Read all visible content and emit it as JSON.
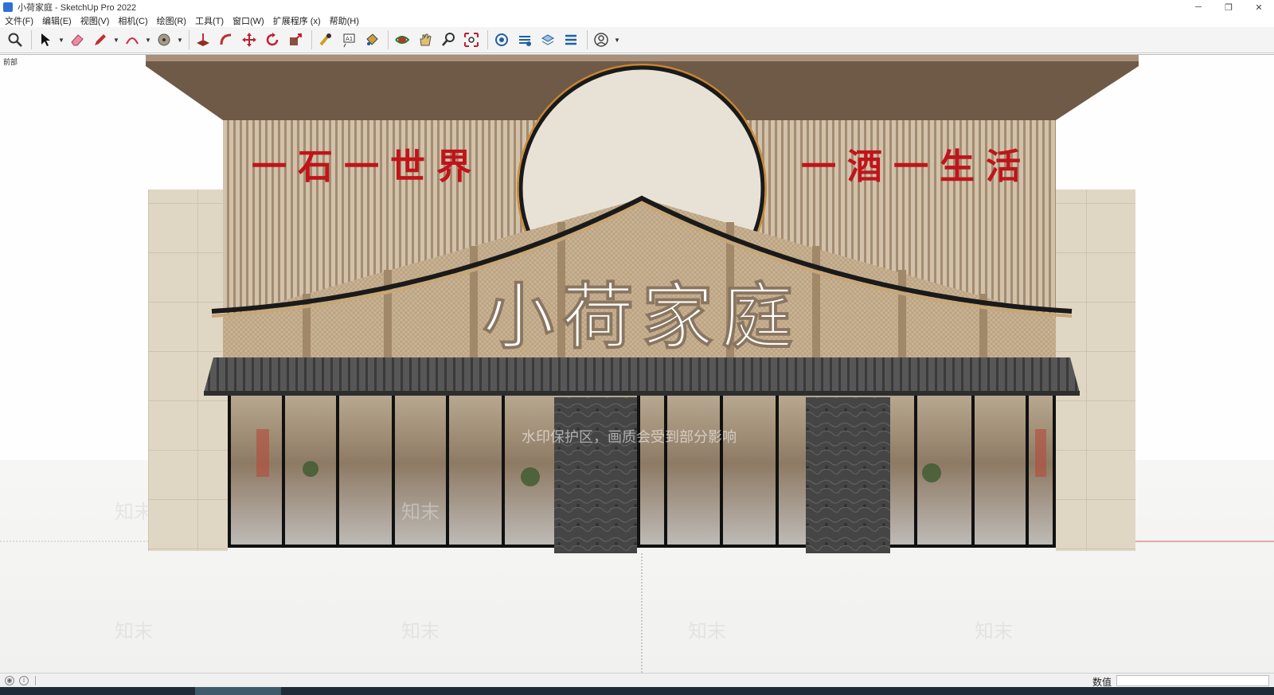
{
  "window": {
    "title": "小荷家庭 - SketchUp Pro 2022",
    "minimize_icon": "minimize-icon",
    "restore_icon": "restore-icon",
    "close_icon": "close-icon"
  },
  "menu": [
    "文件(F)",
    "编辑(E)",
    "视图(V)",
    "相机(C)",
    "绘图(R)",
    "工具(T)",
    "窗口(W)",
    "扩展程序 (x)",
    "帮助(H)"
  ],
  "toolbar": {
    "tools": [
      "zoom-icon",
      "select-icon",
      "eraser-icon",
      "pencil-icon",
      "arc-icon",
      "circle-tool-icon",
      "push-pull-icon",
      "follow-me-icon",
      "move-icon",
      "rotate-icon",
      "scale-icon",
      "tape-measure-icon",
      "text-icon",
      "paint-bucket-icon",
      "orbit-icon",
      "pan-icon",
      "zoom-tool-icon",
      "zoom-extents-icon",
      "warehouse-icon",
      "extension-warehouse-icon",
      "layout-icon",
      "extension-manager-icon",
      "account-icon"
    ]
  },
  "viewport": {
    "scene_label": "前部",
    "left_slogan": "一石一世界",
    "right_slogan": "一酒一生活",
    "sign": "小荷家庭",
    "watermark_text": "水印保护区，画质会受到部分影响",
    "watermark_logo": "知末"
  },
  "status": {
    "measurements_label": "数值",
    "measurements_value": ""
  },
  "colors": {
    "wood": "#c9b79f",
    "roof": "#6f5a47",
    "sign_red": "#c0141a",
    "tile": "#4d4d4d",
    "stone": "#3f3f3f"
  }
}
